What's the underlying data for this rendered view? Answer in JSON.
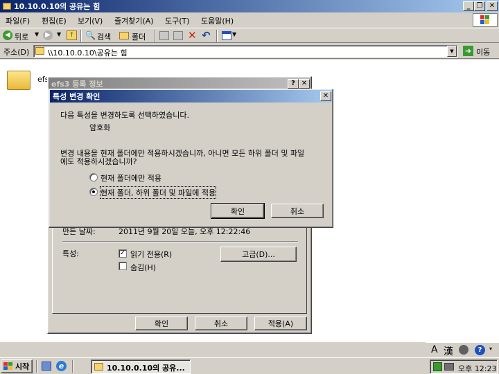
{
  "window": {
    "title": "10.10.0.10의 공유는 힘"
  },
  "menu": [
    "파일(F)",
    "편집(E)",
    "보기(V)",
    "즐겨찾기(A)",
    "도구(T)",
    "도움말(H)"
  ],
  "toolbar": {
    "back": "뒤로",
    "search": "검색",
    "folders": "폴더"
  },
  "address": {
    "label": "주소(D)",
    "value": "\\\\10.10.0.10\\공유는 힘",
    "go": "이동"
  },
  "folder": {
    "name": "efs"
  },
  "properties": {
    "title": "efs3 등록 정보",
    "created_label": "만든 날짜:",
    "created_value": "2011년 9월 20일 오늘, 오후 12:22:46",
    "attributes_label": "특성:",
    "readonly_label": "읽기 전용(R)",
    "hidden_label": "숨김(H)",
    "advanced_button": "고급(D)...",
    "ok": "확인",
    "cancel": "취소",
    "apply": "적용(A)",
    "readonly_checked": true,
    "hidden_checked": false
  },
  "confirm": {
    "title": "특성 변경 확인",
    "message": "다음 특성을 변경하도록 선택하였습니다.",
    "attribute": "암호화",
    "question_line1": "변경 내용을 현재 폴더에만 적용하시겠습니까, 아니면 모든 하위 폴더 및 파일",
    "question_line2": "에도 적용하시겠습니까?",
    "option_folder_only": "현재 폴더에만 적용",
    "option_all": "현재 폴더, 하위 폴더 및 파일에 적용",
    "selected_option": "option_all",
    "ok": "확인",
    "cancel": "취소"
  },
  "language_bar": {
    "mode": "A",
    "hanja": "漢"
  },
  "taskbar": {
    "start": "시작",
    "task": "10.10.0.10의 공유...",
    "clock": "오후 12:23"
  },
  "colors": {
    "title_active": "#0a246a",
    "title_inactive": "#808080",
    "face": "#d4d0c8"
  }
}
